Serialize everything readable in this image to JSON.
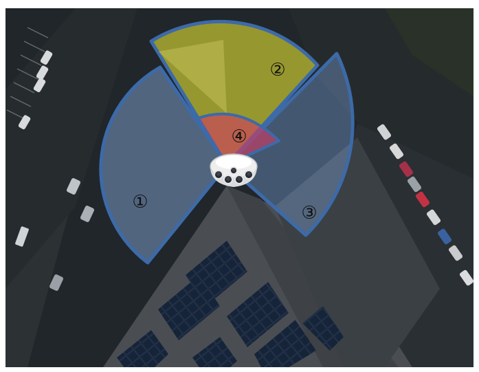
{
  "zones": [
    {
      "id": "1",
      "label": "①",
      "fill": "#8fb4e6",
      "stroke": "#3d6aa8"
    },
    {
      "id": "2",
      "label": "②",
      "fill": "#e8e234",
      "stroke": "#3d6aa8"
    },
    {
      "id": "3",
      "label": "③",
      "fill": "#7aa3da",
      "stroke": "#3d6aa8"
    },
    {
      "id": "4",
      "label": "④",
      "fill": "#d23a63",
      "stroke": "#3d6aa8"
    }
  ],
  "colors": {
    "frame": "#ffffff",
    "ground": "#1f2427",
    "roof": "#474b4f",
    "solar_panel": "#0e1726",
    "camera_body": "#f2f2f2",
    "camera_lens": "#1b1d22"
  },
  "icons": {
    "camera": "multi-sensor-dome-camera-icon"
  }
}
